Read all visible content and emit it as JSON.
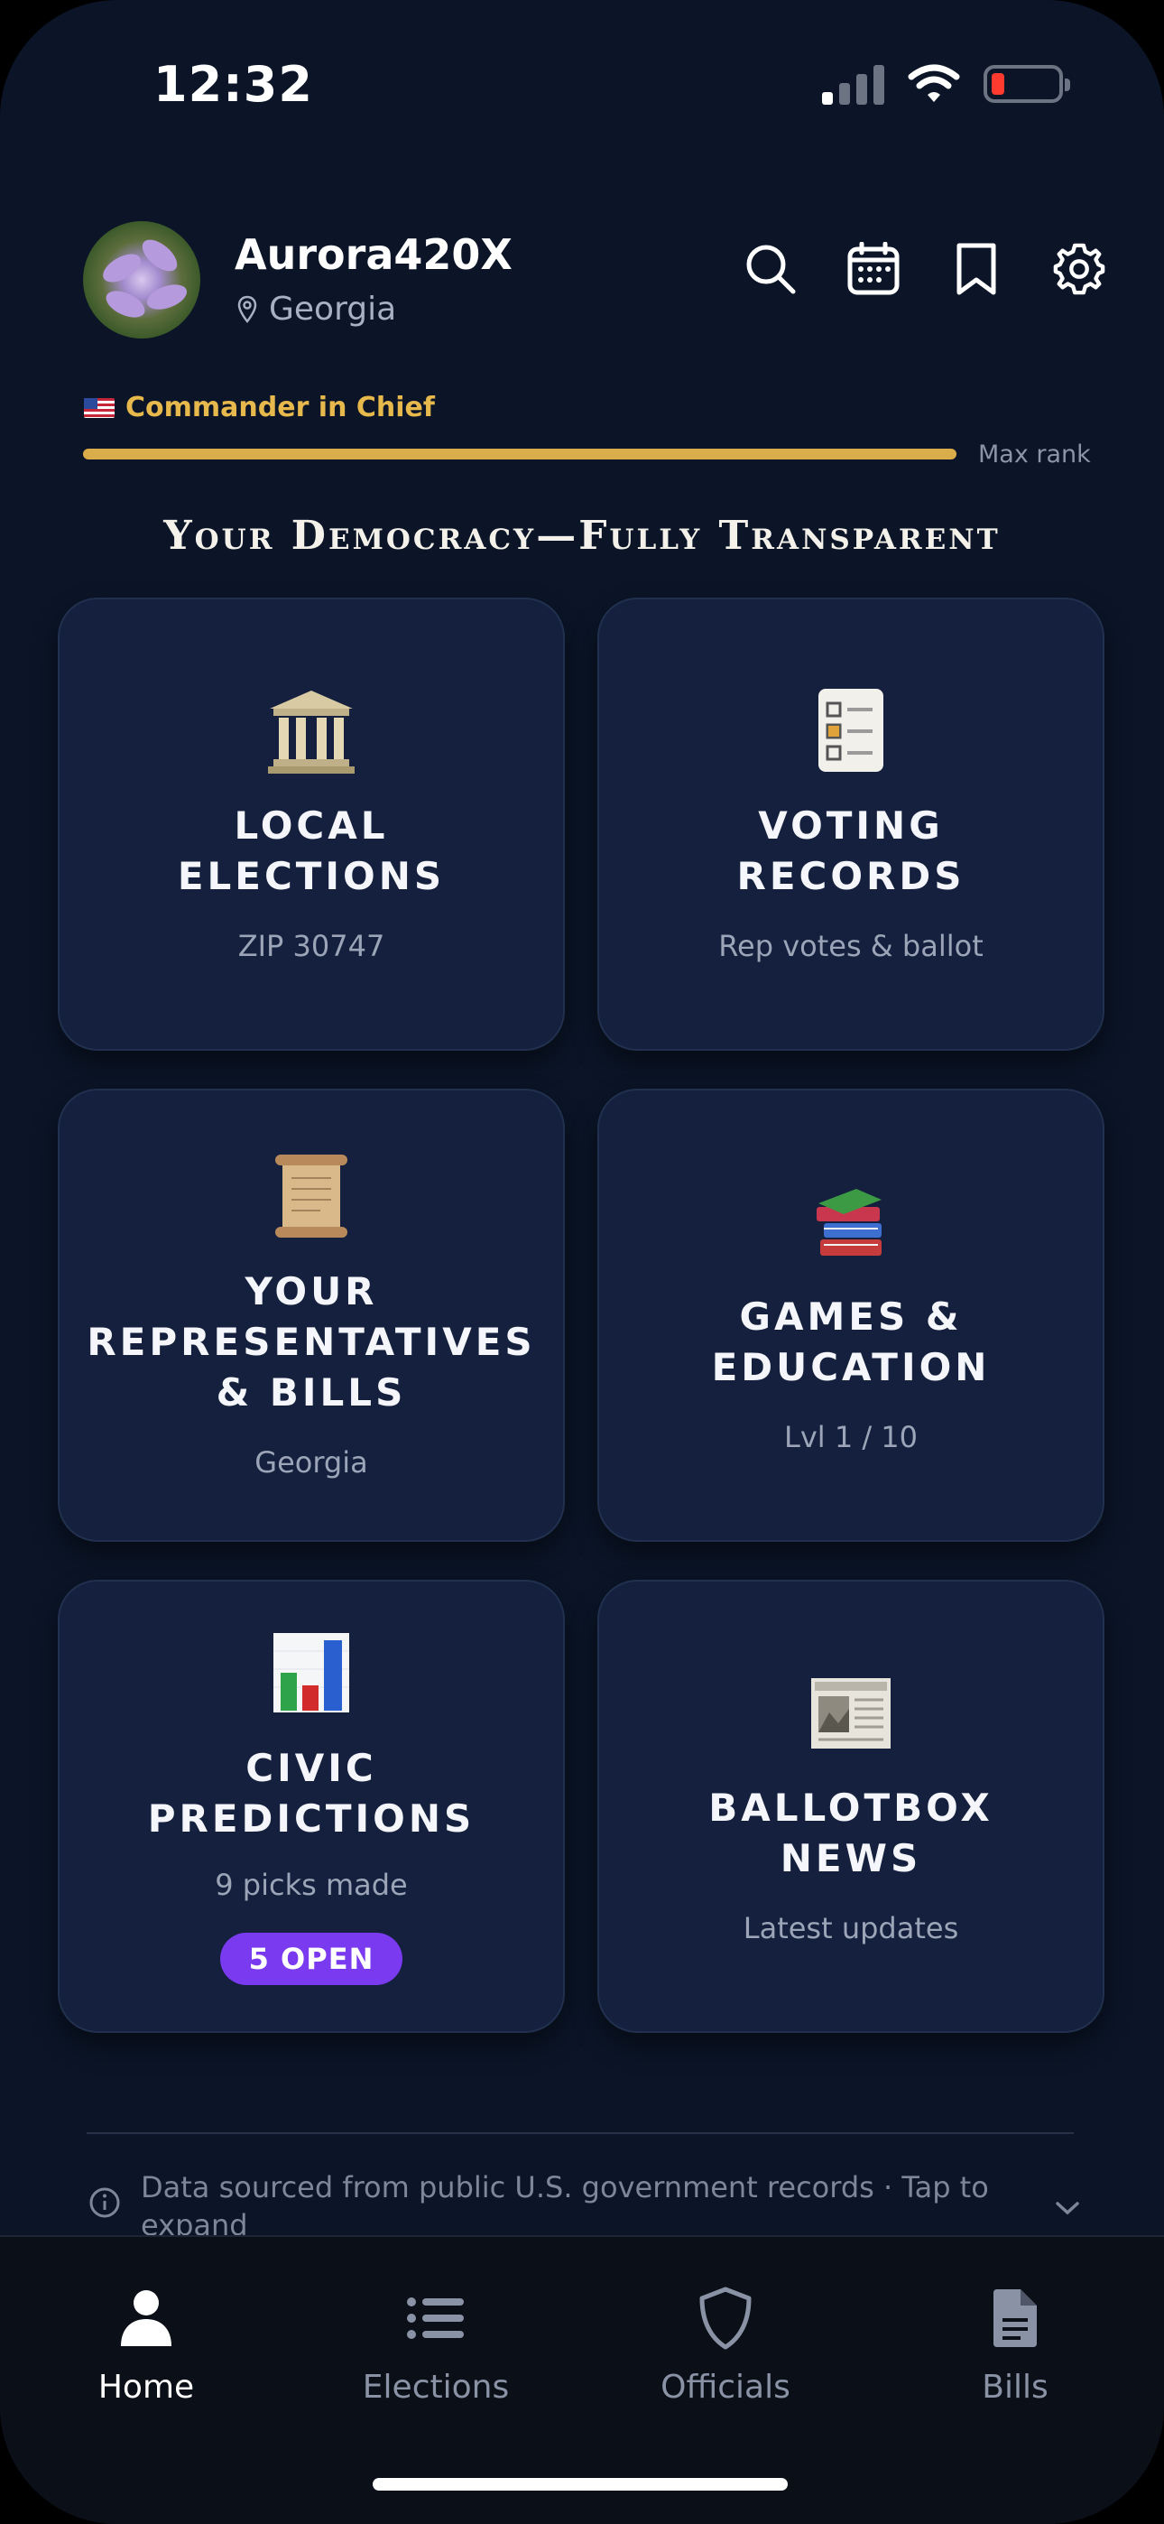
{
  "status_bar": {
    "time": "12:32"
  },
  "profile": {
    "username": "Aurora420X",
    "location": "Georgia",
    "rank": "Commander in Chief",
    "rank_progress": 1.0,
    "rank_status": "Max rank"
  },
  "tagline": "Your Democracy—Fully Transparent",
  "cards": [
    {
      "title_lines": [
        "LOCAL",
        "ELECTIONS"
      ],
      "subtitle": "ZIP 30747",
      "icon": "classical-building-icon"
    },
    {
      "title_lines": [
        "VOTING",
        "RECORDS"
      ],
      "subtitle": "Rep votes & ballot",
      "icon": "checklist-icon"
    },
    {
      "title_lines": [
        "YOUR",
        "REPRESENTATIVES",
        "& BILLS"
      ],
      "subtitle": "Georgia",
      "icon": "scroll-icon"
    },
    {
      "title_lines": [
        "GAMES &",
        "EDUCATION"
      ],
      "subtitle": "Lvl 1 / 10",
      "icon": "books-icon"
    },
    {
      "title_lines": [
        "CIVIC",
        "PREDICTIONS"
      ],
      "subtitle": "9 picks made",
      "badge": "5 OPEN",
      "icon": "bar-chart-icon"
    },
    {
      "title_lines": [
        "BALLOTBOX",
        "NEWS"
      ],
      "subtitle": "Latest updates",
      "icon": "newspaper-icon"
    }
  ],
  "source_note": "Data sourced from public U.S. government records · Tap to expand",
  "nav": [
    {
      "label": "Home",
      "active": true
    },
    {
      "label": "Elections",
      "active": false
    },
    {
      "label": "Officials",
      "active": false
    },
    {
      "label": "Bills",
      "active": false
    }
  ],
  "colors": {
    "background": "#0b1527",
    "card": "#14203d",
    "accent_gold": "#e7b84b",
    "badge_purple": "#7a3bf0"
  }
}
